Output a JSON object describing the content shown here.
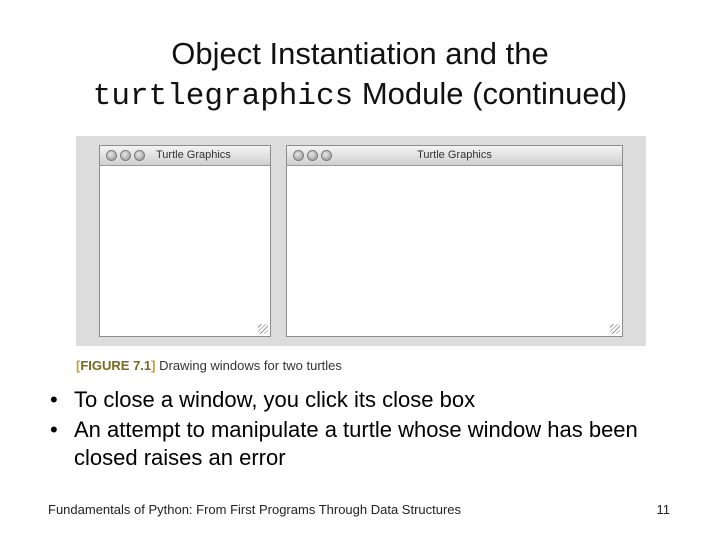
{
  "slide": {
    "title_line1": "Object Instantiation and the",
    "title_code": "turtlegraphics",
    "title_rest": " Module (continued)"
  },
  "figure": {
    "windows": [
      {
        "title": "Turtle Graphics"
      },
      {
        "title": "Turtle Graphics"
      }
    ],
    "caption_label": "FIGURE 7.1",
    "caption_text": "Drawing windows for two turtles"
  },
  "bullets": [
    "To close a window, you click its close box",
    "An attempt to manipulate a turtle whose window has been closed raises an error"
  ],
  "footer": {
    "text": "Fundamentals of Python: From First Programs Through Data Structures",
    "page_number": "11"
  }
}
